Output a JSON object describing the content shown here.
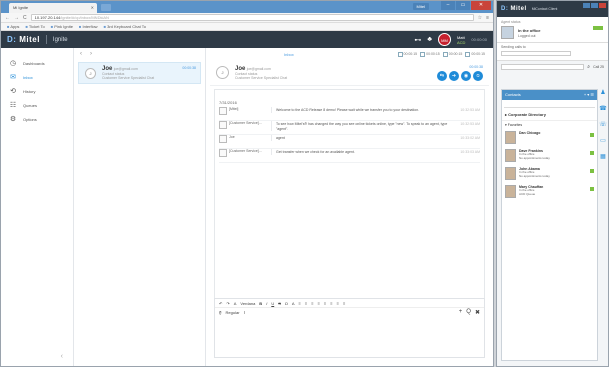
{
  "browser": {
    "tab_title": "Mi Ignite",
    "url_host": "10.197.20.144",
    "url_path": "/ignite/#/cp/inbox/MNDkiAN",
    "user_chip": "Mitel",
    "bookmarks": [
      "Apps",
      "Ticket To",
      "Pink Ignite",
      "Interflow",
      "3rd Keyboard Chat To"
    ]
  },
  "app": {
    "logo_prefix": "D:",
    "logo": "Mitel",
    "name": "Ignite",
    "user_initials": "MM",
    "user_name": "Matt",
    "user_state": "ACD",
    "clock": "00:00:00"
  },
  "nav": {
    "items": [
      {
        "label": "Dashboards",
        "icon": "◷"
      },
      {
        "label": "Inbox",
        "icon": "✉"
      },
      {
        "label": "History",
        "icon": "⟲"
      },
      {
        "label": "Queues",
        "icon": "☷"
      },
      {
        "label": "Options",
        "icon": "⚙"
      }
    ]
  },
  "conversation_item": {
    "name": "Joe",
    "email": "joe@gmail.com",
    "line1": "Contact status",
    "line2": "Customer Service Specialist Chat",
    "time": "00:00:38"
  },
  "chat": {
    "inbox_label": "Inbox",
    "toolbar_buttons": [
      "00:00:15",
      "00:00:15",
      "00:00:15",
      "00:00:15"
    ],
    "header_name": "Joe",
    "header_email": "joe@gmail.com",
    "header_line1": "Contact status",
    "header_line2": "Customer Service Specialist Chat",
    "header_time": "00:00:38",
    "date_label": "7/31/2016",
    "messages": [
      {
        "sender": "[Mitel]",
        "text": "Welcome to the ACD Release 8 demo! Please wait while we transfer you to your destination.",
        "time": "10:32:53 AM"
      },
      {
        "sender": "[Customer Service]...",
        "text": "To see how Mitel’s® has changed the way you see online tickets online, type \"new\". To speak to an agent, type \"agent\".",
        "time": "10:32:53 AM"
      },
      {
        "sender": "Joe",
        "text": "agent",
        "time": "10:33:02 AM"
      },
      {
        "sender": "[Customer Service]...",
        "text": "Get transfer when we check for an available agent.",
        "time": "10:33:03 AM"
      }
    ]
  },
  "composer": {
    "font_label": "Verdana",
    "size_label": "Regular",
    "row1": [
      "B",
      "I",
      "U",
      "S",
      "Ω",
      "A",
      "≡",
      "≡",
      "≡",
      "≡",
      "≡",
      "≡",
      "≡",
      "≡"
    ],
    "icons": [
      "+",
      "Q",
      "✖"
    ]
  },
  "panel": {
    "logo": "Mitel",
    "agent": "MiContact Client",
    "status_label": "Agent status",
    "status_name": "In the office",
    "status_sub": "Logged out",
    "note_label": "Sending calls to",
    "search_chip": "Call 25",
    "contacts_title": "Contacts",
    "directory": "Corporate Directory",
    "group": "Favorites",
    "people": [
      {
        "name": "Dan Chicago",
        "line1": "",
        "line2": ""
      },
      {
        "name": "Dave Frankins",
        "line1": "In the office",
        "line2": "No appointments today"
      },
      {
        "name": "John Abama",
        "line1": "In the office",
        "line2": "No appointments today"
      },
      {
        "name": "Mary Chauffan",
        "line1": "In the office",
        "line2": "ACD Queue"
      }
    ]
  }
}
